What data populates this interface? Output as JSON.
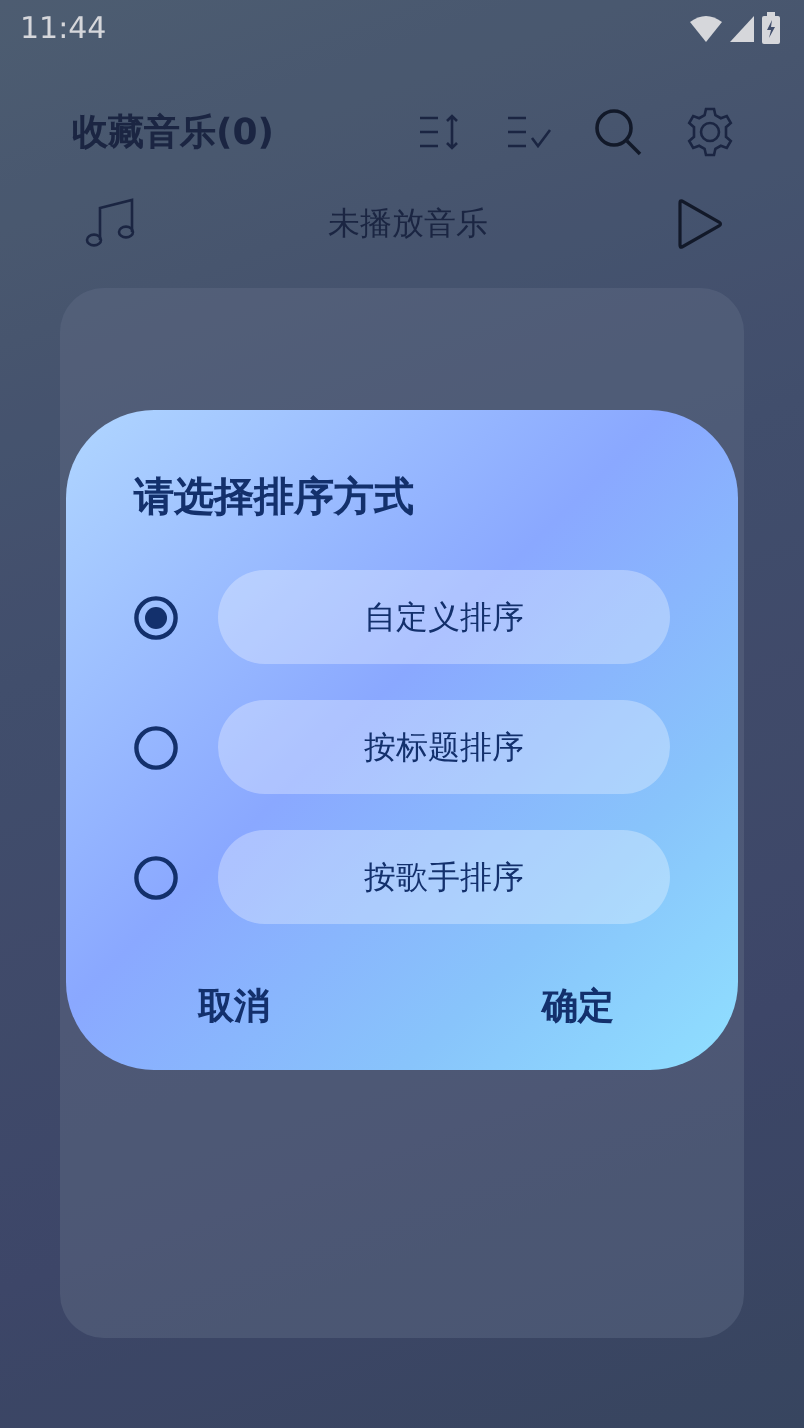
{
  "status_bar": {
    "time": "11:44"
  },
  "header": {
    "title": "收藏音乐(0)"
  },
  "player": {
    "track": "未播放音乐"
  },
  "dialog": {
    "title": "请选择排序方式",
    "options": [
      {
        "label": "自定义排序",
        "selected": true
      },
      {
        "label": "按标题排序",
        "selected": false
      },
      {
        "label": "按歌手排序",
        "selected": false
      }
    ],
    "buttons": [
      "取消",
      "确定"
    ]
  }
}
